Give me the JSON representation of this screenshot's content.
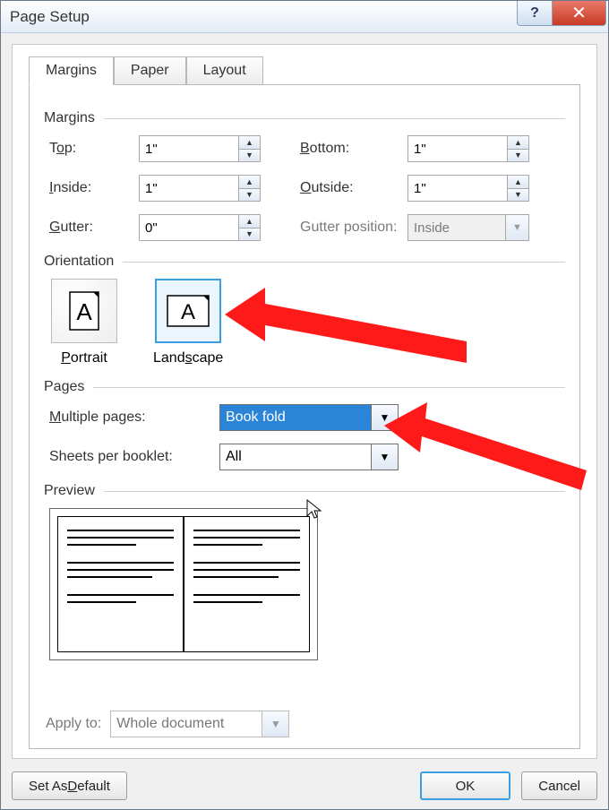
{
  "titlebar": {
    "title": "Page Setup"
  },
  "tabs": {
    "margins": "Margins",
    "paper": "Paper",
    "layout": "Layout"
  },
  "section": {
    "margins": "Margins",
    "orientation": "Orientation",
    "pages": "Pages",
    "preview": "Preview"
  },
  "margins": {
    "top_label_pre": "T",
    "top_label_u": "o",
    "top_label_post": "p:",
    "bottom_label_pre": "",
    "bottom_label_u": "B",
    "bottom_label_post": "ottom:",
    "inside_label_pre": "",
    "inside_label_u": "I",
    "inside_label_post": "nside:",
    "outside_label_pre": "",
    "outside_label_u": "O",
    "outside_label_post": "utside:",
    "gutter_label_pre": "",
    "gutter_label_u": "G",
    "gutter_label_post": "utter:",
    "gutterpos_label": "Gutter position:",
    "top": "1\"",
    "bottom": "1\"",
    "inside": "1\"",
    "outside": "1\"",
    "gutter": "0\"",
    "gutterpos": "Inside"
  },
  "orientation": {
    "portrait_pre": "",
    "portrait_u": "P",
    "portrait_post": "ortrait",
    "landscape_pre": "Land",
    "landscape_u": "s",
    "landscape_post": "cape"
  },
  "pages": {
    "multiple_label_pre": "",
    "multiple_label_u": "M",
    "multiple_label_post": "ultiple pages:",
    "multiple_value": "Book fold",
    "sheets_label": "Sheets per booklet:",
    "sheets_value": "All"
  },
  "apply": {
    "label": "Apply to:",
    "value": "Whole document"
  },
  "footer": {
    "default_pre": "Set As ",
    "default_u": "D",
    "default_post": "efault",
    "ok": "OK",
    "cancel": "Cancel"
  }
}
